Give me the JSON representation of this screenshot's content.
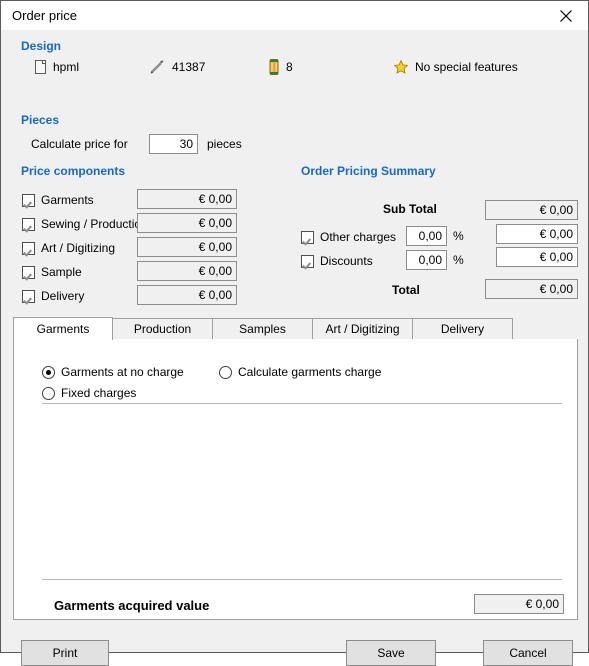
{
  "window": {
    "title": "Order price",
    "close_icon": "close-icon"
  },
  "design": {
    "heading": "Design",
    "items": [
      {
        "icon": "document-icon",
        "label": "hpml"
      },
      {
        "icon": "pencil-icon",
        "label": "41387"
      },
      {
        "icon": "thread-spool-icon",
        "label": "8"
      },
      {
        "icon": "star-icon",
        "label": "No special features"
      }
    ]
  },
  "pieces": {
    "heading": "Pieces",
    "label": "Calculate price for",
    "value": "30",
    "unit": "pieces"
  },
  "price_components": {
    "heading": "Price components",
    "rows": [
      {
        "label": "Garments",
        "checked": true,
        "value": "€ 0,00"
      },
      {
        "label": "Sewing / Production",
        "checked": true,
        "value": "€ 0,00"
      },
      {
        "label": "Art / Digitizing",
        "checked": true,
        "value": "€ 0,00"
      },
      {
        "label": "Sample",
        "checked": true,
        "value": "€ 0,00"
      },
      {
        "label": "Delivery",
        "checked": true,
        "value": "€ 0,00"
      }
    ]
  },
  "summary": {
    "heading": "Order Pricing Summary",
    "sub_total_label": "Sub Total",
    "sub_total_value": "€ 0,00",
    "other_charges_label": "Other charges",
    "other_charges_checked": true,
    "other_charges_percent": "0,00",
    "other_charges_value": "€ 0,00",
    "discounts_label": "Discounts",
    "discounts_checked": true,
    "discounts_percent": "0,00",
    "discounts_value": "€ 0,00",
    "percent_symbol": "%",
    "total_label": "Total",
    "total_value": "€ 0,00"
  },
  "tabs": [
    {
      "label": "Garments",
      "active": true
    },
    {
      "label": "Production",
      "active": false
    },
    {
      "label": "Samples",
      "active": false
    },
    {
      "label": "Art / Digitizing",
      "active": false
    },
    {
      "label": "Delivery",
      "active": false
    }
  ],
  "garments_tab": {
    "options": [
      {
        "label": "Garments at no charge",
        "selected": true
      },
      {
        "label": "Calculate garments charge",
        "selected": false
      },
      {
        "label": "Fixed charges",
        "selected": false
      }
    ],
    "acquired_value_label": "Garments acquired value",
    "acquired_value": "€ 0,00"
  },
  "footer": {
    "print": "Print",
    "save": "Save",
    "cancel": "Cancel"
  },
  "colors": {
    "accent_heading": "#1569c7",
    "window_bg": "#f0f0f0",
    "panel_bg": "#ffffff",
    "star": "#f2c818",
    "spool": "#e8a317"
  }
}
